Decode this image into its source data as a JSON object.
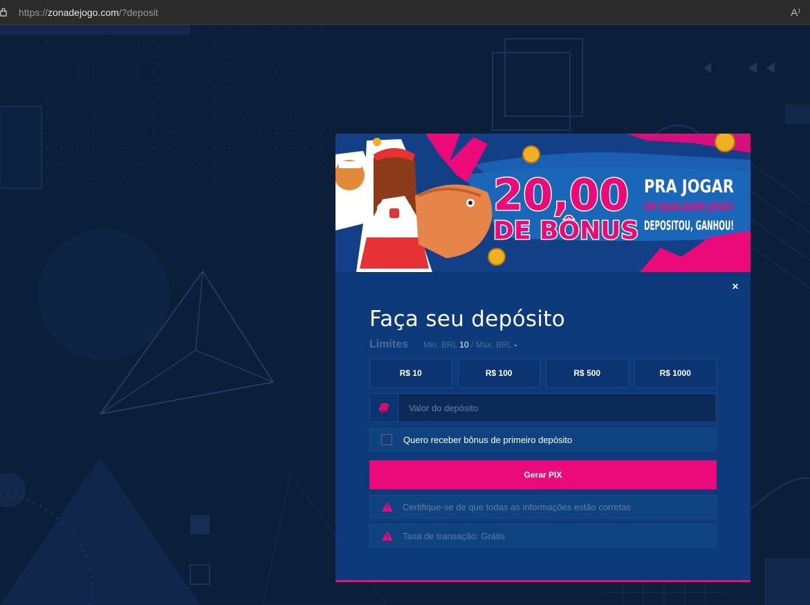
{
  "browser": {
    "url_scheme": "https://",
    "url_domain": "zonadejogo.com",
    "url_path": "/?deposit",
    "read_aloud_label": "A⁾"
  },
  "banner": {
    "amount": "20,00",
    "bonus_text": "DE BÔNUS",
    "line1": "PRA JOGAR",
    "line2": "EM QUALQUER JOGO!",
    "line3": "DEPOSITOU, GANHOU!",
    "colors": {
      "bg": "#0d3a7a",
      "pink": "#ec0a7b"
    }
  },
  "modal": {
    "close_glyph": "×",
    "title": "Faça seu depósito",
    "limits_label": "Limites",
    "min_label": "Min. BRL",
    "min_value": "10",
    "separator": "/",
    "max_label": "Max. BRL",
    "max_value": "-",
    "quick_amounts": [
      "R$ 10",
      "R$ 100",
      "R$ 500",
      "R$ 1000"
    ],
    "amount_placeholder": "Valor do depósito",
    "bonus_checkbox_label": "Quero receber bônus de primeiro depósito",
    "bonus_checked": false,
    "generate_button": "Gerar PIX",
    "notices": [
      "Certifique-se de que todas as informações estão corretas",
      "Taxa de transação: Grátis"
    ]
  },
  "colors": {
    "page_bg": "#0c1f3a",
    "modal_bg": "#0d3a7a",
    "accent": "#ec0a7b"
  }
}
